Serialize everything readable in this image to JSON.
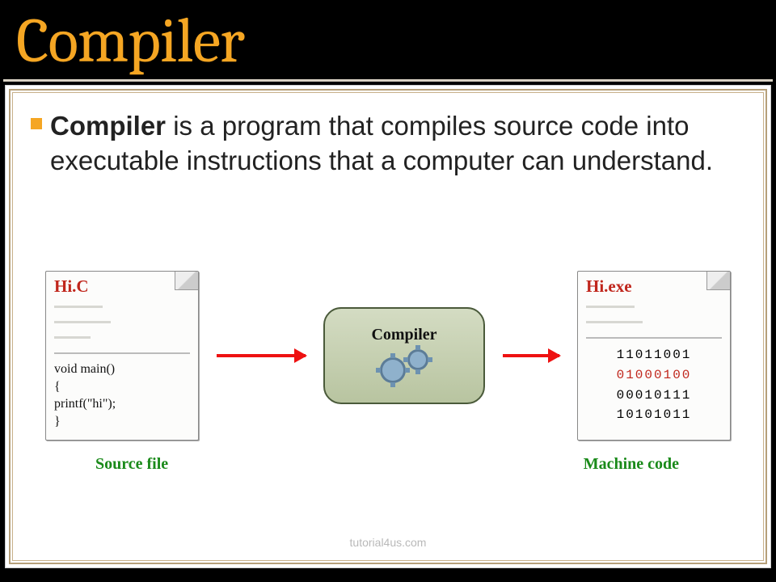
{
  "title": "Compiler",
  "bullet": {
    "lead": "Compiler",
    "rest": " is a program that compiles source code into executable instructions that a computer can understand."
  },
  "diagram": {
    "source_file": {
      "title": "Hi.C",
      "code": "void main()\n{\nprintf(\"hi\");\n}",
      "caption": "Source file"
    },
    "compiler": {
      "label": "Compiler"
    },
    "output_file": {
      "title": "Hi.exe",
      "lines": [
        "11011001",
        "01000100",
        "00010111",
        "10101011"
      ],
      "highlight_index": 1,
      "caption": "Machine code"
    },
    "watermark": "tutorial4us.com"
  }
}
